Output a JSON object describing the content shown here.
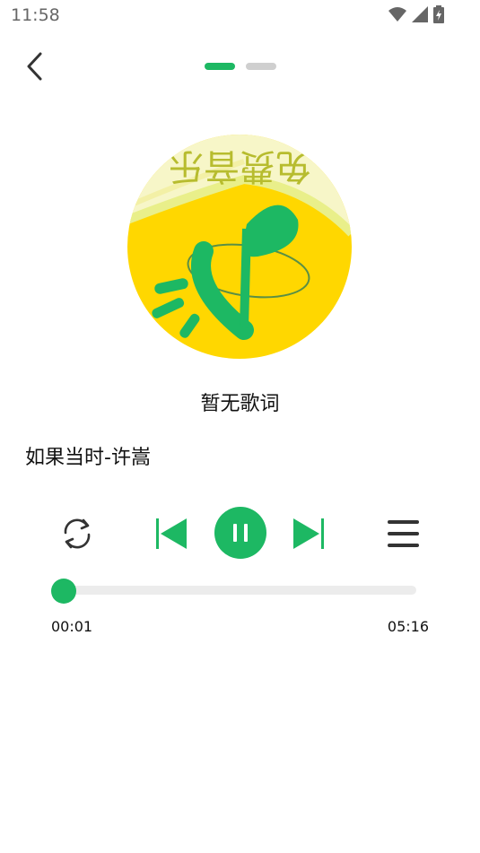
{
  "status_bar": {
    "time": "11:58",
    "icons": [
      "wifi-icon",
      "signal-icon",
      "battery-charging-icon"
    ]
  },
  "header": {
    "back_icon": "chevron-left-icon",
    "pages": [
      {
        "state": "active"
      },
      {
        "state": "inactive"
      }
    ]
  },
  "album": {
    "art": "music-note-logo",
    "art_text": "免费音乐"
  },
  "lyrics": {
    "text": "暂无歌词"
  },
  "song": {
    "title": "如果当时-许嵩"
  },
  "controls": {
    "repeat_icon": "repeat-icon",
    "prev_icon": "skip-previous-icon",
    "play_state_icon": "pause-icon",
    "next_icon": "skip-next-icon",
    "playlist_icon": "menu-icon"
  },
  "progress": {
    "current": "00:01",
    "total": "05:16",
    "fraction": 0.003
  },
  "colors": {
    "accent": "#1db863",
    "track": "#ececec",
    "inactive_dot": "#cfcfcf",
    "album_yellow": "#ffd700"
  }
}
